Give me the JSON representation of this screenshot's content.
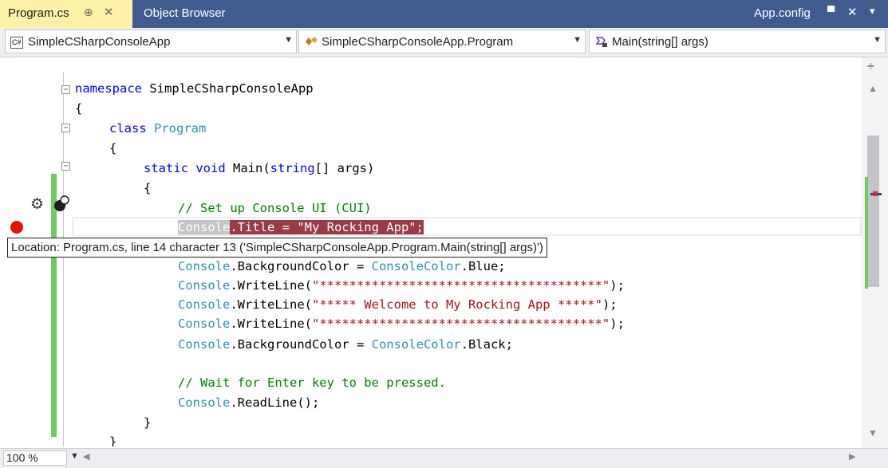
{
  "tabs": {
    "active_label": "Program.cs",
    "pin_glyph": "⊕",
    "close_glyph": "✕",
    "second_label": "Object Browser",
    "right_label": "App.config",
    "right_pin_glyph": "▀",
    "right_close_glyph": "✕",
    "right_dropdown_glyph": "▾"
  },
  "navbar": {
    "project": "SimpleCSharpConsoleApp",
    "project_icon": "C#",
    "class": "SimpleCSharpConsoleApp.Program",
    "member": "Main(string[] args)"
  },
  "code": {
    "l_namespace_kw": "namespace",
    "l_namespace_name": " SimpleCSharpConsoleApp",
    "l_brace_open1": "{",
    "l_class_kw": "class",
    "l_class_name": " Program",
    "l_brace_open2": "{",
    "l_static": "static",
    "l_void": " void",
    "l_main": " Main(",
    "l_string": "string",
    "l_args": "[] args)",
    "l_brace_open3": "{",
    "l_comment1": "// Set up Console UI (CUI)",
    "l_title_console": "Console",
    "l_title_rest": ".Title = \"My Rocking App\";",
    "l_bg_console": "Console",
    "l_bg_mid": ".BackgroundColor = ",
    "l_bg_type": "ConsoleColor",
    "l_bg_blue": ".Blue;",
    "l_wl1_console": "Console",
    "l_wl1_mid": ".WriteLine(",
    "l_wl1_str": "\"**************************************\"",
    "l_wl1_end": ");",
    "l_wl2_console": "Console",
    "l_wl2_mid": ".WriteLine(",
    "l_wl2_str": "\"***** Welcome to My Rocking App *****\"",
    "l_wl2_end": ");",
    "l_wl3_console": "Console",
    "l_wl3_mid": ".WriteLine(",
    "l_wl3_str": "\"**************************************\"",
    "l_wl3_end": ");",
    "l_bg2_console": "Console",
    "l_bg2_mid": ".BackgroundColor = ",
    "l_bg2_type": "ConsoleColor",
    "l_bg2_black": ".Black;",
    "l_comment2": "// Wait for Enter key to be pressed.",
    "l_rl_console": "Console",
    "l_rl_rest": ".ReadLine();",
    "l_brace_close3": "}",
    "l_brace_close2": "}"
  },
  "tooltip": "Location: Program.cs, line 14 character 13 ('SimpleCSharpConsoleApp.Program.Main(string[] args)')",
  "zoom": "100 %",
  "colors": {
    "tab_bar": "#405b8e",
    "active_tab": "#fff1a7",
    "breakpoint": "#e51400",
    "change_bar": "#6ecc5f",
    "keyword": "#0000ff",
    "type": "#2b91af",
    "comment": "#008000",
    "string": "#a31515"
  }
}
